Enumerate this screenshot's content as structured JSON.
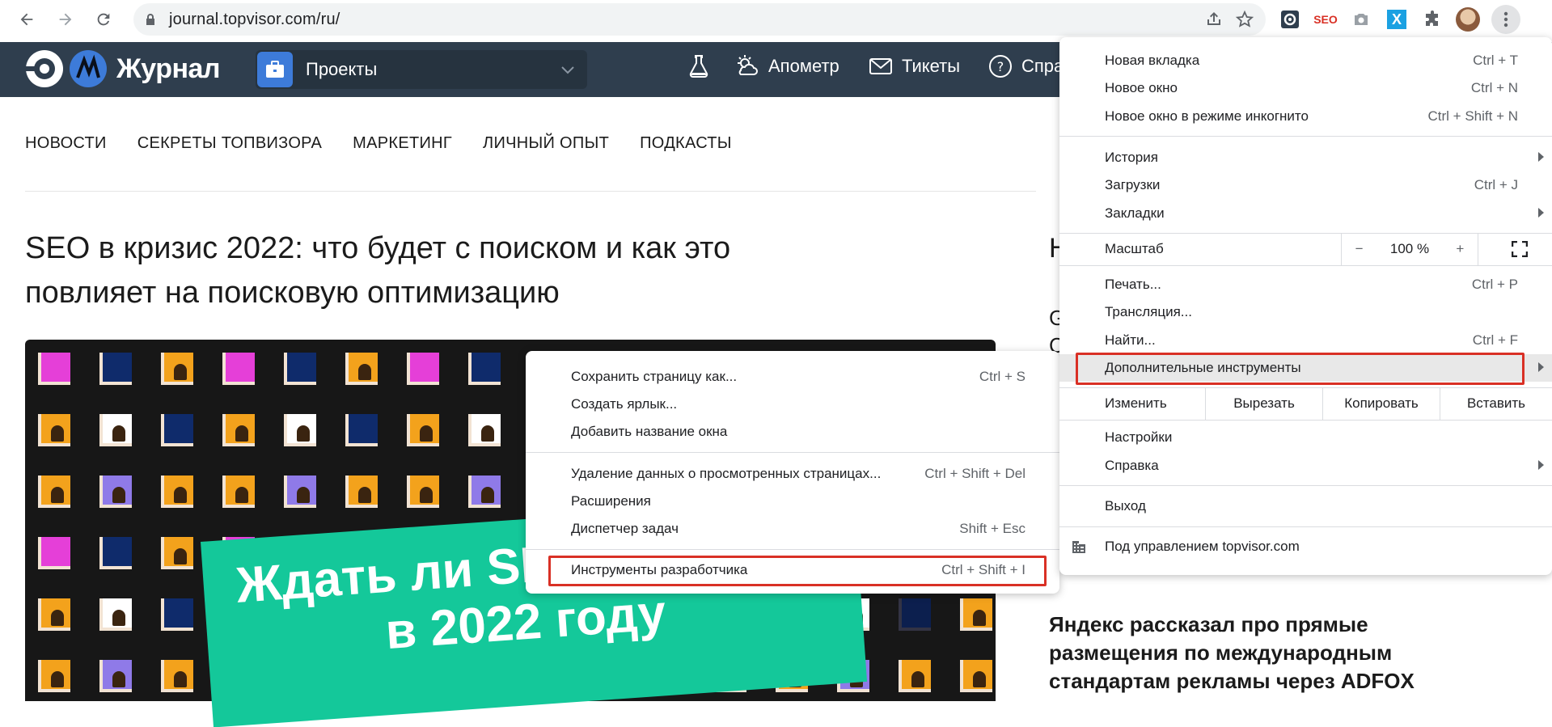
{
  "browser": {
    "url": "journal.topvisor.com/ru/",
    "extensions": [
      "topvisor-ext-icon",
      "seo-ext-icon",
      "camera-ext-icon",
      "x-ext-icon",
      "puzzle-icon"
    ],
    "seo_ext_label": "SEO",
    "x_ext_label": "X"
  },
  "site": {
    "logo_text": "Журнал",
    "projects_label": "Проекты",
    "nav": [
      {
        "label": ""
      },
      {
        "label": "Апометр"
      },
      {
        "label": "Тикеты"
      },
      {
        "label": "Спра"
      }
    ],
    "categories": [
      "НОВОСТИ",
      "СЕКРЕТЫ ТОПВИЗОРА",
      "МАРКЕТИНГ",
      "ЛИЧНЫЙ ОПЫТ",
      "ПОДКАСТЫ"
    ],
    "headline": "SEO в кризис 2022: что будет с поиском и как это повлияет на поисковую оптимизацию",
    "banner_line1": "Ждать ли SEO-р",
    "banner_line2": "в 2022 году",
    "side_fragment_1": "Н",
    "side_fragment_2": "G",
    "side_fragment_3": "С",
    "side_article": "Яндекс рассказал про прямые размещения по международным стандартам рекламы через ADFOX"
  },
  "menu": {
    "new_tab": {
      "label": "Новая вкладка",
      "shortcut": "Ctrl + T"
    },
    "new_window": {
      "label": "Новое окно",
      "shortcut": "Ctrl + N"
    },
    "incognito": {
      "label": "Новое окно в режиме инкогнито",
      "shortcut": "Ctrl + Shift + N"
    },
    "history": {
      "label": "История"
    },
    "downloads": {
      "label": "Загрузки",
      "shortcut": "Ctrl + J"
    },
    "bookmarks": {
      "label": "Закладки"
    },
    "zoom": {
      "label": "Масштаб",
      "minus": "−",
      "value": "100 %",
      "plus": "+"
    },
    "print": {
      "label": "Печать...",
      "shortcut": "Ctrl + P"
    },
    "cast": {
      "label": "Трансляция..."
    },
    "find": {
      "label": "Найти...",
      "shortcut": "Ctrl + F"
    },
    "more_tools": {
      "label": "Дополнительные инструменты"
    },
    "edit": {
      "label": "Изменить",
      "cut": "Вырезать",
      "copy": "Копировать",
      "paste": "Вставить"
    },
    "settings": {
      "label": "Настройки"
    },
    "help": {
      "label": "Справка"
    },
    "exit": {
      "label": "Выход"
    },
    "managed": {
      "label": "Под управлением topvisor.com"
    }
  },
  "submenu": {
    "save_page": {
      "label": "Сохранить страницу как...",
      "shortcut": "Ctrl + S"
    },
    "create_shortcut": {
      "label": "Создать ярлык..."
    },
    "name_window": {
      "label": "Добавить название окна"
    },
    "clear_data": {
      "label": "Удаление данных о просмотренных страницах...",
      "shortcut": "Ctrl + Shift + Del"
    },
    "extensions": {
      "label": "Расширения"
    },
    "task_manager": {
      "label": "Диспетчер задач",
      "shortcut": "Shift + Esc"
    },
    "devtools": {
      "label": "Инструменты разработчика",
      "shortcut": "Ctrl + Shift + I"
    }
  },
  "colors": {
    "header_bg": "#2f3e4e",
    "banner": "#14c89a",
    "highlight_box": "#d93025"
  }
}
